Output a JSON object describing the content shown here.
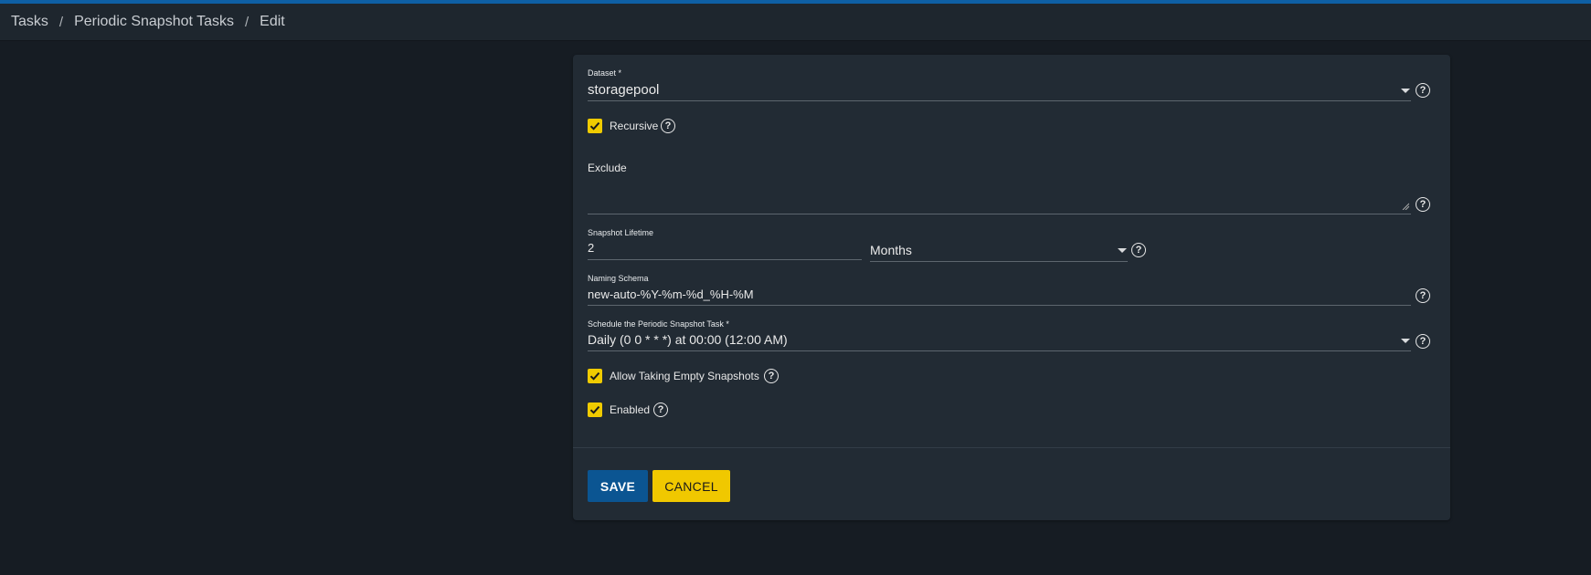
{
  "breadcrumb": {
    "items": [
      "Tasks",
      "Periodic Snapshot Tasks"
    ],
    "separator": "/",
    "current": "Edit"
  },
  "form": {
    "dataset": {
      "label": "Dataset *",
      "value": "storagepool"
    },
    "recursive": {
      "label": "Recursive",
      "checked": true
    },
    "exclude": {
      "label": "Exclude",
      "value": ""
    },
    "lifetime": {
      "label": "Snapshot Lifetime",
      "value": "2",
      "unit": "Months"
    },
    "naming_schema": {
      "label": "Naming Schema",
      "value": "new-auto-%Y-%m-%d_%H-%M"
    },
    "schedule": {
      "label": "Schedule the Periodic Snapshot Task *",
      "value": "Daily (0 0 * * *) at 00:00 (12:00 AM)"
    },
    "allow_empty": {
      "label": "Allow Taking Empty Snapshots",
      "checked": true
    },
    "enabled": {
      "label": "Enabled",
      "checked": true
    }
  },
  "help_glyph": "?",
  "buttons": {
    "save": "SAVE",
    "cancel": "CANCEL"
  },
  "colors": {
    "accent_blue": "#0b5592",
    "accent_yellow": "#f0c800",
    "card_bg": "#222b34",
    "page_bg": "#161c23"
  },
  "icons": {
    "help": "help-circle-icon",
    "dropdown": "caret-down-icon",
    "check": "checkmark-icon"
  }
}
